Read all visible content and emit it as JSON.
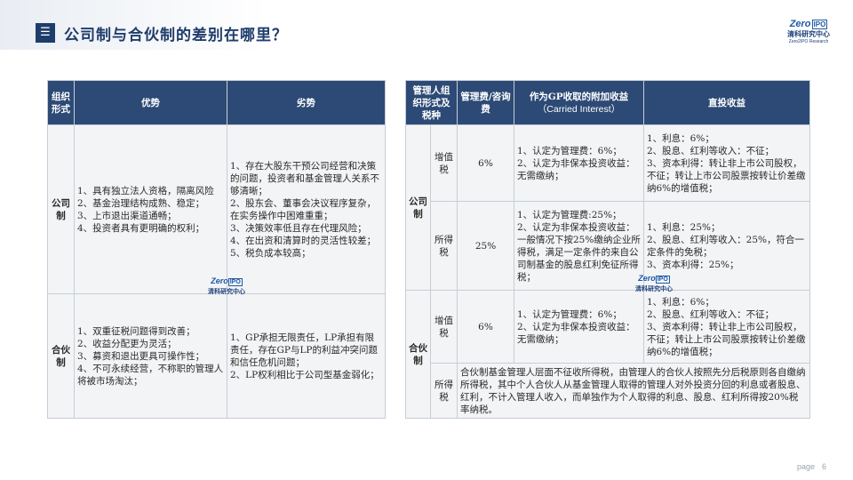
{
  "header": {
    "icon": "menu-icon",
    "icon_glyph": "☰",
    "title": "公司制与合伙制的差别在哪里？"
  },
  "logo": {
    "zero": "Zero",
    "ipo": "IPO",
    "cn": "清科研究中心",
    "en": "Zero2IPO Research"
  },
  "left_table": {
    "headers": [
      "组织形式",
      "优势",
      "劣势"
    ],
    "rows": [
      {
        "form": "公司制",
        "advantages": "1、具有独立法人资格，隔离风险\n2、基金治理结构成熟、稳定；\n3、上市退出渠道通畅；\n4、投资者具有更明确的权利；",
        "disadvantages": "1、存在大股东干预公司经营和决策的问题，投资者和基金管理人关系不够清晰；\n2、股东会、董事会决议程序复杂，在实务操作中困难重重；\n3、决策效率低且存在代理风险；\n4、在出资和清算时的灵活性较差；\n5、税负成本较高；"
      },
      {
        "form": "合伙制",
        "advantages": "1、双重征税问题得到改善；\n2、收益分配更为灵活；\n3、募资和退出更具可操作性；\n4、不可永续经营，不称职的管理人将被市场淘汰；",
        "disadvantages": "1、GP承担无限责任，LP承担有限责任，存在GP与LP的利益冲突问题和信任危机问题；\n2、LP权利相比于公司型基金弱化；"
      }
    ]
  },
  "right_table": {
    "headers": {
      "form_tax": "管理人组织形式及税种",
      "fee": "管理费/咨询费",
      "carry": "作为GP收取的附加收益",
      "carry_en": "（Carried Interest）",
      "direct": "直投收益"
    },
    "company": {
      "label": "公司制",
      "vat": {
        "label": "增值税",
        "fee": "6%",
        "carry": "1、认定为管理费：6%；\n2、认定为非保本投资收益：无需缴纳；",
        "direct": "1、利息：6%；\n2、股息、红利等收入：不征；\n3、资本利得：转让非上市公司股权，不征；转让上市公司股票按转让价差缴纳6%的增值税；"
      },
      "income": {
        "label": "所得税",
        "fee": "25%",
        "carry": "1、认定为管理费:25%；\n2、认定为非保本投资收益：一般情况下按25%缴纳企业所得税，满足一定条件的来自公司制基金的股息红利免征所得税；",
        "direct": "1、利息：25%；\n2、股息、红利等收入：25%，符合一定条件的免税；\n3、资本利得：25%；"
      }
    },
    "partnership": {
      "label": "合伙制",
      "vat": {
        "label": "增值税",
        "fee": "6%",
        "carry": "1、认定为管理费：6%；\n2、认定为非保本投资收益：无需缴纳；",
        "direct": "1、利息：6%；\n2、股息、红利等收入：不征；\n3、资本利得：转让非上市公司股权，不征；转让上市公司股票按转让价差缴纳6%的增值税；"
      },
      "income": {
        "label": "所得税",
        "text": "合伙制基金管理人层面不征收所得税，由管理人的合伙人按照先分后税原则各自缴纳所得税，其中个人合伙人从基金管理人取得的管理人对外投资分回的利息或者股息、红利，不计入管理人收入，而单独作为个人取得的利息、股息、红利所得按20%税率纳税。"
      }
    }
  },
  "footer": {
    "page_label": "page",
    "page_number": "6"
  }
}
